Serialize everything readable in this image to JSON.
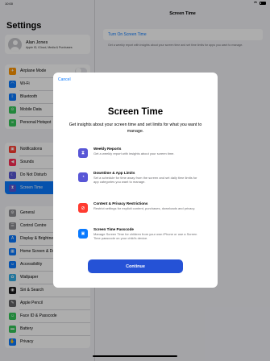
{
  "status_bar": {
    "time": "10:00"
  },
  "sidebar": {
    "title": "Settings",
    "profile": {
      "name": "Alan Jones",
      "subtitle": "Apple ID, iCloud, Media & Purchases"
    },
    "group1": [
      {
        "label": "Airplane Mode",
        "icon": "airplane-icon",
        "glyph": "✈",
        "color": "#ff9500",
        "toggle": true
      },
      {
        "label": "Wi-Fi",
        "icon": "wifi-icon",
        "glyph": "◠",
        "color": "#0a7aff"
      },
      {
        "label": "Bluetooth",
        "icon": "bluetooth-icon",
        "glyph": "ᛒ",
        "color": "#0a7aff"
      },
      {
        "label": "Mobile Data",
        "icon": "antenna-icon",
        "glyph": "⊙",
        "color": "#34c759"
      },
      {
        "label": "Personal Hotspot",
        "icon": "hotspot-icon",
        "glyph": "∞",
        "color": "#34c759"
      }
    ],
    "group2": [
      {
        "label": "Notifications",
        "icon": "notifications-icon",
        "glyph": "▣",
        "color": "#ff3b30"
      },
      {
        "label": "Sounds",
        "icon": "speaker-icon",
        "glyph": "◀",
        "color": "#ff2d55"
      },
      {
        "label": "Do Not Disturb",
        "icon": "moon-icon",
        "glyph": "☾",
        "color": "#5856d6"
      },
      {
        "label": "Screen Time",
        "icon": "hourglass-icon",
        "glyph": "⧗",
        "color": "#5856d6",
        "selected": true
      }
    ],
    "group3": [
      {
        "label": "General",
        "icon": "gear-icon",
        "glyph": "⚙",
        "color": "#8e8e93"
      },
      {
        "label": "Control Centre",
        "icon": "switches-icon",
        "glyph": "☰",
        "color": "#8e8e93"
      },
      {
        "label": "Display & Brightness",
        "icon": "text-size-icon",
        "glyph": "A",
        "color": "#0a7aff"
      },
      {
        "label": "Home Screen & Dock",
        "icon": "grid-icon",
        "glyph": "▦",
        "color": "#0a7aff"
      },
      {
        "label": "Accessibility",
        "icon": "accessibility-icon",
        "glyph": "☺",
        "color": "#0a7aff"
      },
      {
        "label": "Wallpaper",
        "icon": "flower-icon",
        "glyph": "✿",
        "color": "#32ade6"
      },
      {
        "label": "Siri & Search",
        "icon": "siri-icon",
        "glyph": "◉",
        "color": "#1c1c1e"
      },
      {
        "label": "Apple Pencil",
        "icon": "pencil-icon",
        "glyph": "✎",
        "color": "#636366"
      },
      {
        "label": "Face ID & Passcode",
        "icon": "face-id-icon",
        "glyph": "☺",
        "color": "#34c759"
      },
      {
        "label": "Battery",
        "icon": "battery-icon",
        "glyph": "▬",
        "color": "#34c759"
      },
      {
        "label": "Privacy",
        "icon": "hand-icon",
        "glyph": "✋",
        "color": "#0a7aff"
      }
    ]
  },
  "detail": {
    "title": "Screen Time",
    "link": "Turn On Screen Time",
    "description": "Get a weekly report with insights about your screen time and set time limits for apps you want to manage."
  },
  "modal": {
    "cancel": "Cancel",
    "title": "Screen Time",
    "subtitle": "Get insights about your screen time and set limits for what you want to manage.",
    "features": [
      {
        "title": "Weekly Reports",
        "desc": "Get a weekly report with insights about your screen time.",
        "icon": "hourglass-icon",
        "glyph": "⧗",
        "color": "#5856d6"
      },
      {
        "title": "Downtime & App Limits",
        "desc": "Set a schedule for time away from the screen and set daily time limits for app categories you want to manage.",
        "icon": "clock-icon",
        "glyph": "◔",
        "color": "#5856d6"
      },
      {
        "title": "Content & Privacy Restrictions",
        "desc": "Restrict settings for explicit content, purchases, downloads and privacy.",
        "icon": "restriction-icon",
        "glyph": "⊘",
        "color": "#ff3b30"
      },
      {
        "title": "Screen Time Passcode",
        "desc": "Manage Screen Time for children from your own iPhone or use a Screen Time passcode on your child's device.",
        "icon": "lock-icon",
        "glyph": "🔒",
        "color": "#0a7aff"
      }
    ],
    "continue": "Continue"
  }
}
